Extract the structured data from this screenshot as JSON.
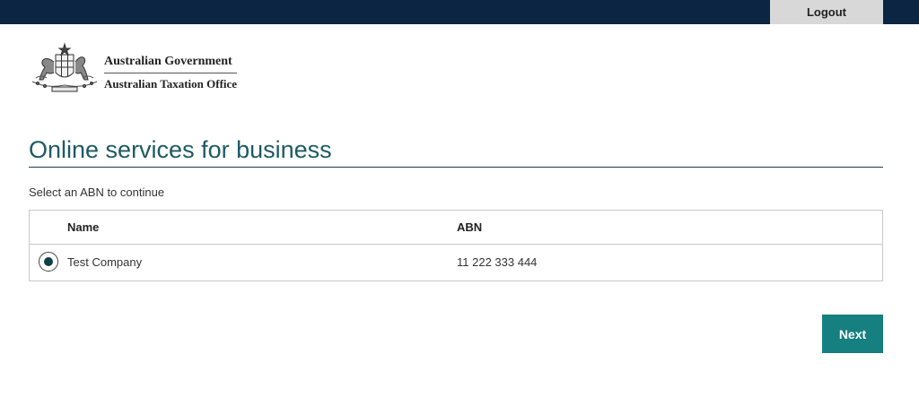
{
  "header": {
    "logout_label": "Logout"
  },
  "logo": {
    "line1": "Australian Government",
    "line2": "Australian Taxation Office",
    "icon": "coat-of-arms"
  },
  "main": {
    "title": "Online services for business",
    "instruction": "Select an ABN to continue",
    "table": {
      "columns": [
        "Name",
        "ABN"
      ],
      "rows": [
        {
          "name": "Test Company",
          "abn": "11 222 333 444",
          "selected": true
        }
      ]
    },
    "next_label": "Next"
  },
  "colors": {
    "topbar": "#0b2542",
    "title": "#1e5a63",
    "button": "#167f7f",
    "logout_bg": "#d8d8d8"
  }
}
